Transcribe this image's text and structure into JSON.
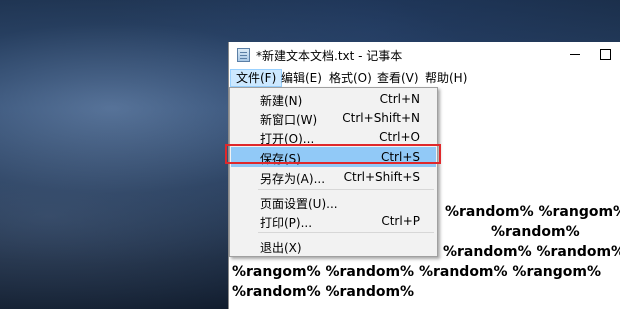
{
  "window": {
    "title": "*新建文本文档.txt - 记事本",
    "icon": "notepad-icon"
  },
  "menubar": {
    "items": [
      {
        "label": "文件(F)"
      },
      {
        "label": "编辑(E)"
      },
      {
        "label": "格式(O)"
      },
      {
        "label": "查看(V)"
      },
      {
        "label": "帮助(H)"
      }
    ]
  },
  "file_menu": {
    "items": [
      {
        "label": "新建(N)",
        "shortcut": "Ctrl+N"
      },
      {
        "label": "新窗口(W)",
        "shortcut": "Ctrl+Shift+N"
      },
      {
        "label": "打开(O)...",
        "shortcut": "Ctrl+O"
      },
      {
        "label": "保存(S)",
        "shortcut": "Ctrl+S"
      },
      {
        "label": "另存为(A)...",
        "shortcut": "Ctrl+Shift+S"
      },
      {
        "label": "页面设置(U)..."
      },
      {
        "label": "打印(P)...",
        "shortcut": "Ctrl+P"
      },
      {
        "label": "退出(X)"
      }
    ],
    "highlighted": "保存(S)"
  },
  "editor": {
    "lines": [
      "%random% %rangom%",
      "%random%",
      "%random% %random%",
      "%rangom% %random% %random% %rangom%",
      "%random% %random%"
    ]
  },
  "colors": {
    "menu_highlight": "#91c9f7",
    "callout_box": "#e0282b"
  }
}
